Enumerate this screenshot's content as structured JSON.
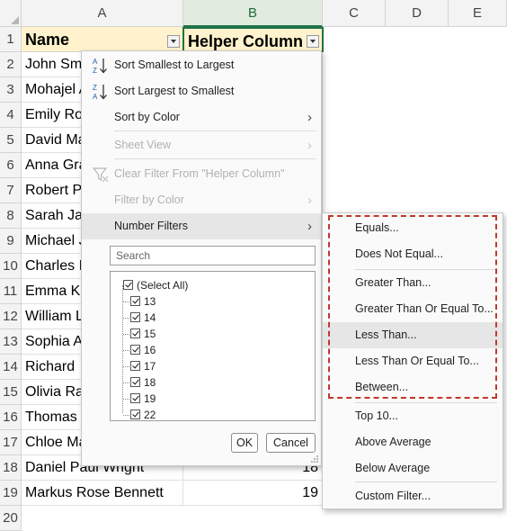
{
  "sheet": {
    "columns": [
      "A",
      "B",
      "C",
      "D",
      "E"
    ],
    "rows": [
      "1",
      "2",
      "3",
      "4",
      "5",
      "6",
      "7",
      "8",
      "9",
      "10",
      "11",
      "12",
      "13",
      "14",
      "15",
      "16",
      "17",
      "18",
      "19",
      "20"
    ],
    "header": {
      "name": "Name",
      "helper": "Helper Column"
    },
    "names": [
      "John Sm",
      "Mohajel A",
      "Emily Ro",
      "David Ma",
      "Anna Gra",
      "Robert P",
      "Sarah Ja",
      "Michael J",
      "Charles I",
      "Emma K",
      "William L",
      "Sophia A",
      "Richard",
      "Olivia Ra",
      "Thomas",
      "Chloe Ma",
      "Daniel Paul Wright",
      "Markus Rose Bennett"
    ],
    "visible_values": {
      "row18": "18",
      "row19": "19"
    }
  },
  "filter_menu": {
    "items": [
      {
        "label": "Sort Smallest to Largest",
        "icon": "sort-ascending-icon"
      },
      {
        "label": "Sort Largest to Smallest",
        "icon": "sort-descending-icon"
      },
      {
        "label": "Sort by Color"
      },
      {
        "label": "Sheet View"
      },
      {
        "label": "Clear Filter From \"Helper Column\"",
        "icon": "clear-filter-icon"
      },
      {
        "label": "Filter by Color"
      },
      {
        "label": "Number Filters"
      }
    ],
    "search_placeholder": "Search",
    "list_items": [
      "(Select All)",
      "13",
      "14",
      "15",
      "16",
      "17",
      "18",
      "19",
      "22"
    ],
    "ok_label": "OK",
    "cancel_label": "Cancel"
  },
  "number_filters_submenu": {
    "items": [
      "Equals...",
      "Does Not Equal...",
      "Greater Than...",
      "Greater Than Or Equal To...",
      "Less Than...",
      "Less Than Or Equal To...",
      "Between...",
      "Top 10...",
      "Above Average",
      "Below Average",
      "Custom Filter..."
    ]
  },
  "colors": {
    "header_fill": "#fff2cc",
    "selection_green": "#217346",
    "highlight_dash": "#c0392b"
  }
}
